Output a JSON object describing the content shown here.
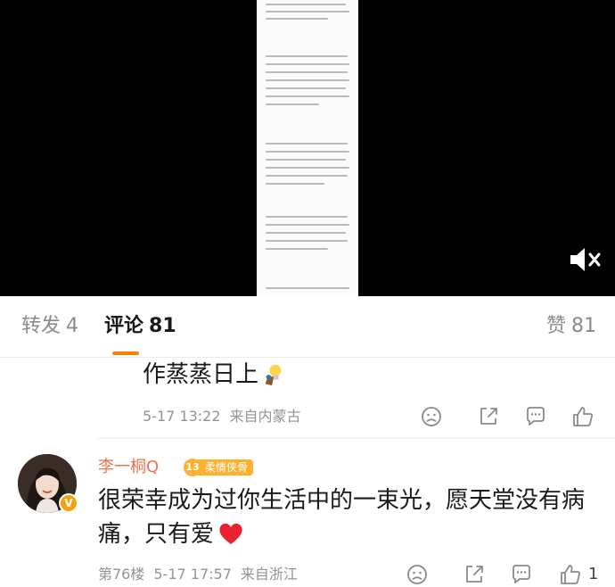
{
  "tabs": {
    "repost_label": "转发",
    "repost_count": "4",
    "comment_label": "评论",
    "comment_count": "81",
    "like_label": "赞",
    "like_count": "81"
  },
  "colors": {
    "accent": "#ff8200",
    "username": "#eb7350",
    "level_badge": "#ffb02e",
    "meta_text": "#939393"
  },
  "comments": [
    {
      "text": "作蒸蒸日上",
      "emoji": "lightbulb-icon",
      "date": "5-17 13:22",
      "source": "来自内蒙古",
      "like_count": ""
    },
    {
      "username": "李一桐Q",
      "level": "13",
      "level_title": "柔情侠骨",
      "verified_badge": "V",
      "text": "很荣幸成为过你生活中的一束光，愿天堂没有病痛，只有爱",
      "emoji": "red-heart-icon",
      "floor": "第76楼",
      "date": "5-17 17:57",
      "source": "来自浙江",
      "like_count": "1"
    }
  ]
}
